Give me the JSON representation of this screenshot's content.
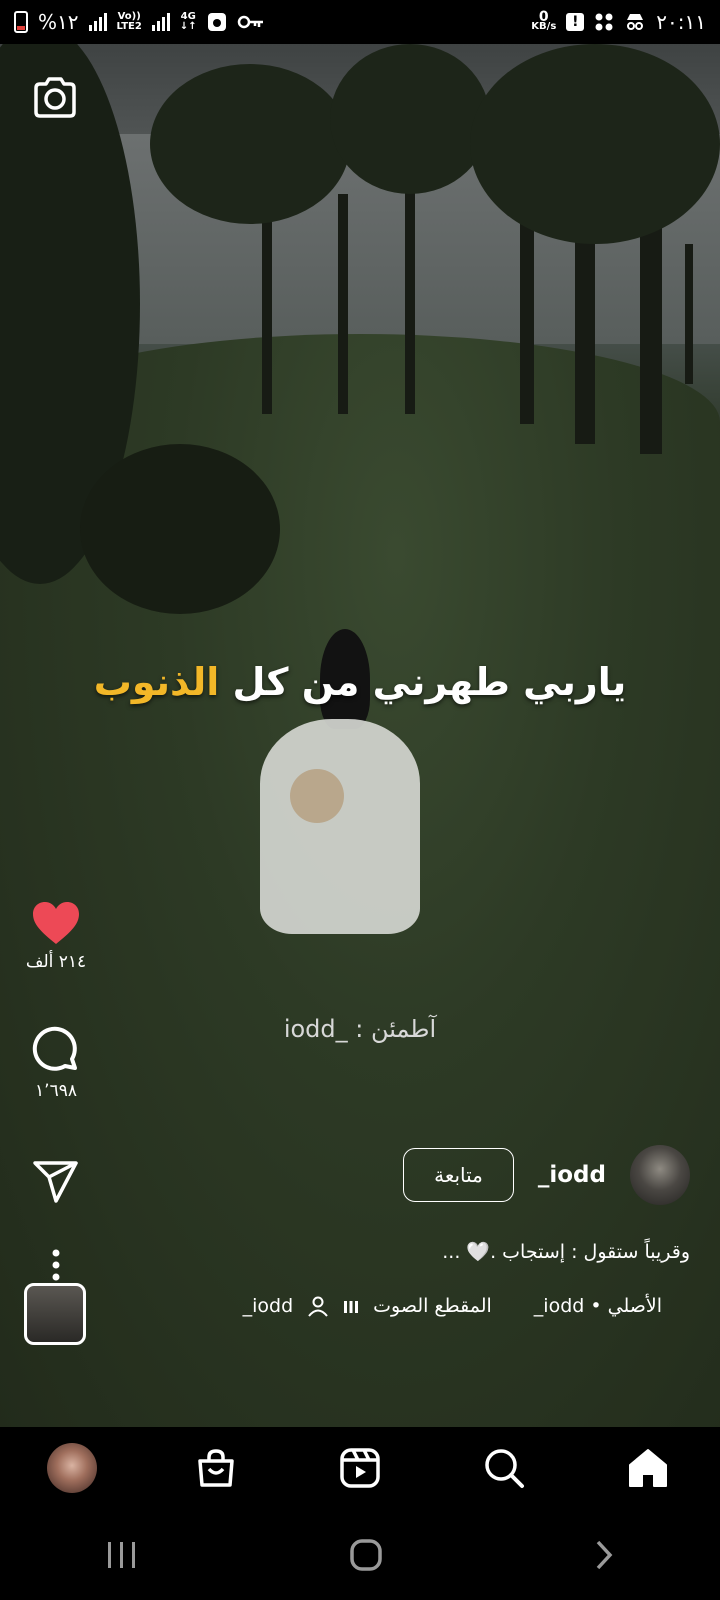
{
  "status_bar": {
    "battery_percent": "%١٢",
    "network_top": "Vo))",
    "network_bottom": "LTE2",
    "network_type": "4G",
    "speed_value": "0",
    "speed_unit": "KB/s",
    "time": "٢٠:١١"
  },
  "reel": {
    "overlay_caption_main": "ياربي طهرني من كل ",
    "overlay_caption_highlight": "الذنوب",
    "overlay_caption_highlight_color": "#f2b728",
    "watermark": "آطمئن : _iodd"
  },
  "actions": {
    "like_count": "٢١٤ ألف",
    "like_color": "#ed4956",
    "comment_count": "١٬٦٩٨"
  },
  "creator": {
    "username": "iodd_",
    "follow_label": "متابعة",
    "description": "وقريباً ستقول : إستجاب .🤍 ..."
  },
  "audio": {
    "original_label": "الأصلي • iodd_",
    "sound_label": "المقطع الصوت",
    "tagged_user": "iodd_"
  },
  "bottom_nav": [
    "home-icon",
    "search-icon",
    "reels-icon",
    "shop-icon",
    "profile-avatar"
  ]
}
